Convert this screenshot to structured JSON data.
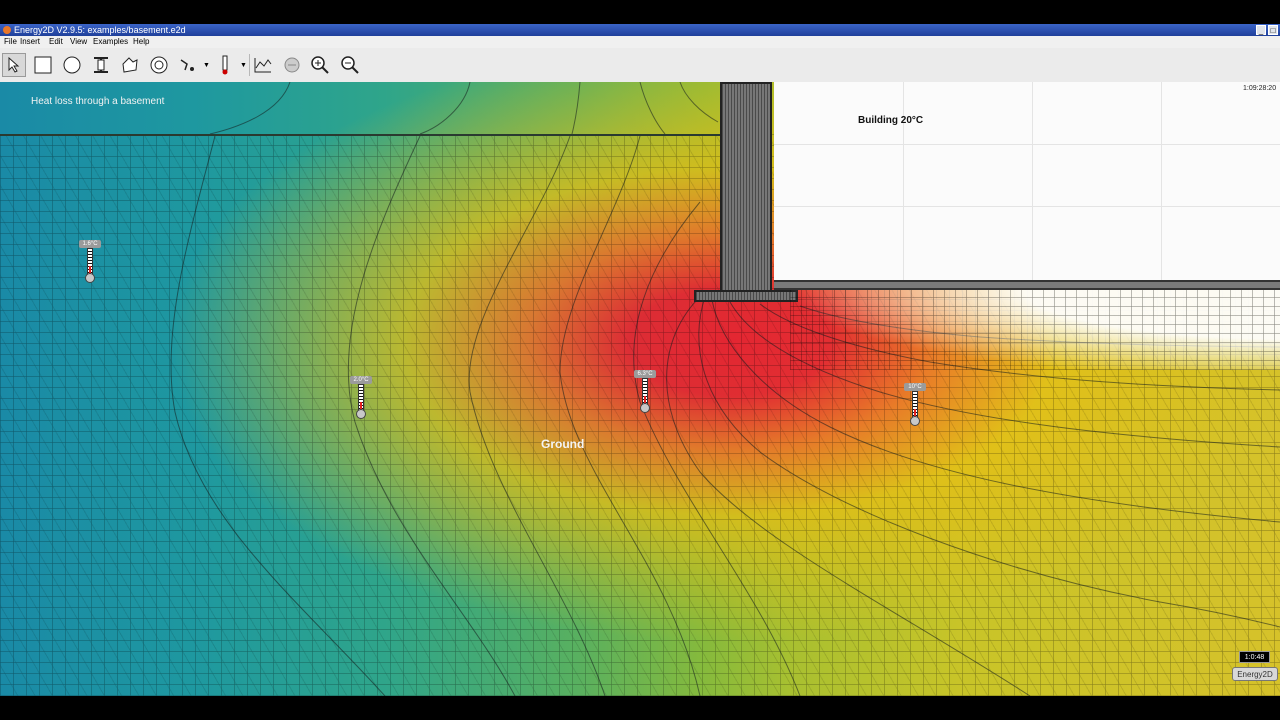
{
  "window": {
    "title": "Energy2D V2.9.5: examples/basement.e2d"
  },
  "menu": {
    "items": [
      "File",
      "Insert",
      "Edit",
      "View",
      "Examples",
      "Help"
    ]
  },
  "toolbar": {
    "icons": [
      "select-arrow-icon",
      "rectangle-icon",
      "ellipse-icon",
      "i-beam-icon",
      "polygon-icon",
      "blob-icon",
      "heliostat-icon",
      "thermometer-icon",
      "graph-icon",
      "heat-flux-icon",
      "zoom-in-icon",
      "zoom-out-icon"
    ]
  },
  "simulation": {
    "title": "Heat loss through a basement",
    "building_label": "Building 20°C",
    "ground_label": "Ground",
    "time_top": "1:09:28:20",
    "clock": "1:0:48",
    "badge": "Energy2D",
    "sensors": [
      {
        "label": "1.6°C"
      },
      {
        "label": "2.0°C"
      },
      {
        "label": "6.3°C"
      },
      {
        "label": "10°C"
      }
    ]
  },
  "colors": {
    "cold": "#1a8aa6",
    "mid": "#86ba3c",
    "warm": "#d6c22a",
    "hot": "#e81e32",
    "building": "#fbfbfb"
  }
}
